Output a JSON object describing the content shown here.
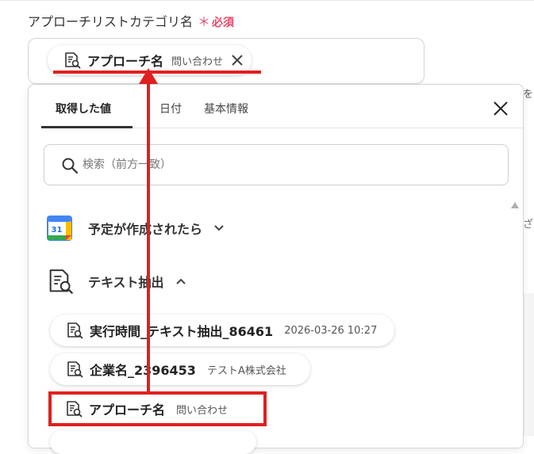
{
  "field": {
    "label": "アプローチリストカテゴリ名",
    "required_star": "＊",
    "required_text": "必須"
  },
  "selected_chip": {
    "name": "アプローチ名",
    "value": "問い合わせ"
  },
  "panel": {
    "tabs": [
      {
        "label": "取得した値",
        "active": true
      },
      {
        "label": "日付",
        "active": false
      },
      {
        "label": "基本情報",
        "active": false
      }
    ],
    "search": {
      "placeholder": "検索（前方一致）"
    },
    "sections": [
      {
        "title": "予定が作成されたら",
        "icon": "google-calendar-icon",
        "expanded": false
      },
      {
        "title": "テキスト抽出",
        "icon": "text-extract-icon",
        "expanded": true
      }
    ],
    "items": [
      {
        "name": "実行時間_テキスト抽出_86461",
        "value": "2026-03-26 10:27"
      },
      {
        "name": "企業名_2396453",
        "value": "テストA株式会社"
      },
      {
        "name": "アプローチ名",
        "value": "問い合わせ"
      }
    ]
  },
  "edge": {
    "text1": "を",
    "text2": "ざ"
  },
  "colors": {
    "required": "#e84a6b",
    "highlight_red": "#e02020",
    "calendar_blue": "#4285F4",
    "calendar_green": "#34A853",
    "calendar_yellow": "#FBBC04",
    "calendar_red": "#EA4335"
  }
}
